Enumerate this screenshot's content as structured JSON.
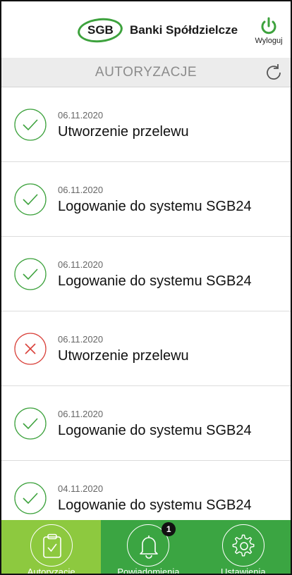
{
  "header": {
    "logo_abbr": "SGB",
    "logo_text": "Banki Spółdzielcze",
    "logout_label": "Wyloguj"
  },
  "titlebar": {
    "title": "AUTORYZACJE"
  },
  "authorizations": [
    {
      "date": "06.11.2020",
      "name": "Utworzenie przelewu",
      "status": "approved"
    },
    {
      "date": "06.11.2020",
      "name": "Logowanie do systemu SGB24",
      "status": "approved"
    },
    {
      "date": "06.11.2020",
      "name": "Logowanie do systemu SGB24",
      "status": "approved"
    },
    {
      "date": "06.11.2020",
      "name": "Utworzenie przelewu",
      "status": "rejected"
    },
    {
      "date": "06.11.2020",
      "name": "Logowanie do systemu SGB24",
      "status": "approved"
    },
    {
      "date": "04.11.2020",
      "name": "Logowanie do systemu SGB24",
      "status": "approved"
    }
  ],
  "nav": {
    "tabs": [
      {
        "label": "Autoryzacje",
        "icon": "clipboard-check-icon",
        "active": true
      },
      {
        "label": "Powiadomienia",
        "icon": "bell-icon",
        "badge": "1"
      },
      {
        "label": "Ustawienia",
        "icon": "gear-icon"
      }
    ]
  },
  "colors": {
    "brand_green": "#3ba542",
    "active_tab_green": "#8dc93f",
    "approved": "#3da23d",
    "rejected": "#d9413a"
  }
}
